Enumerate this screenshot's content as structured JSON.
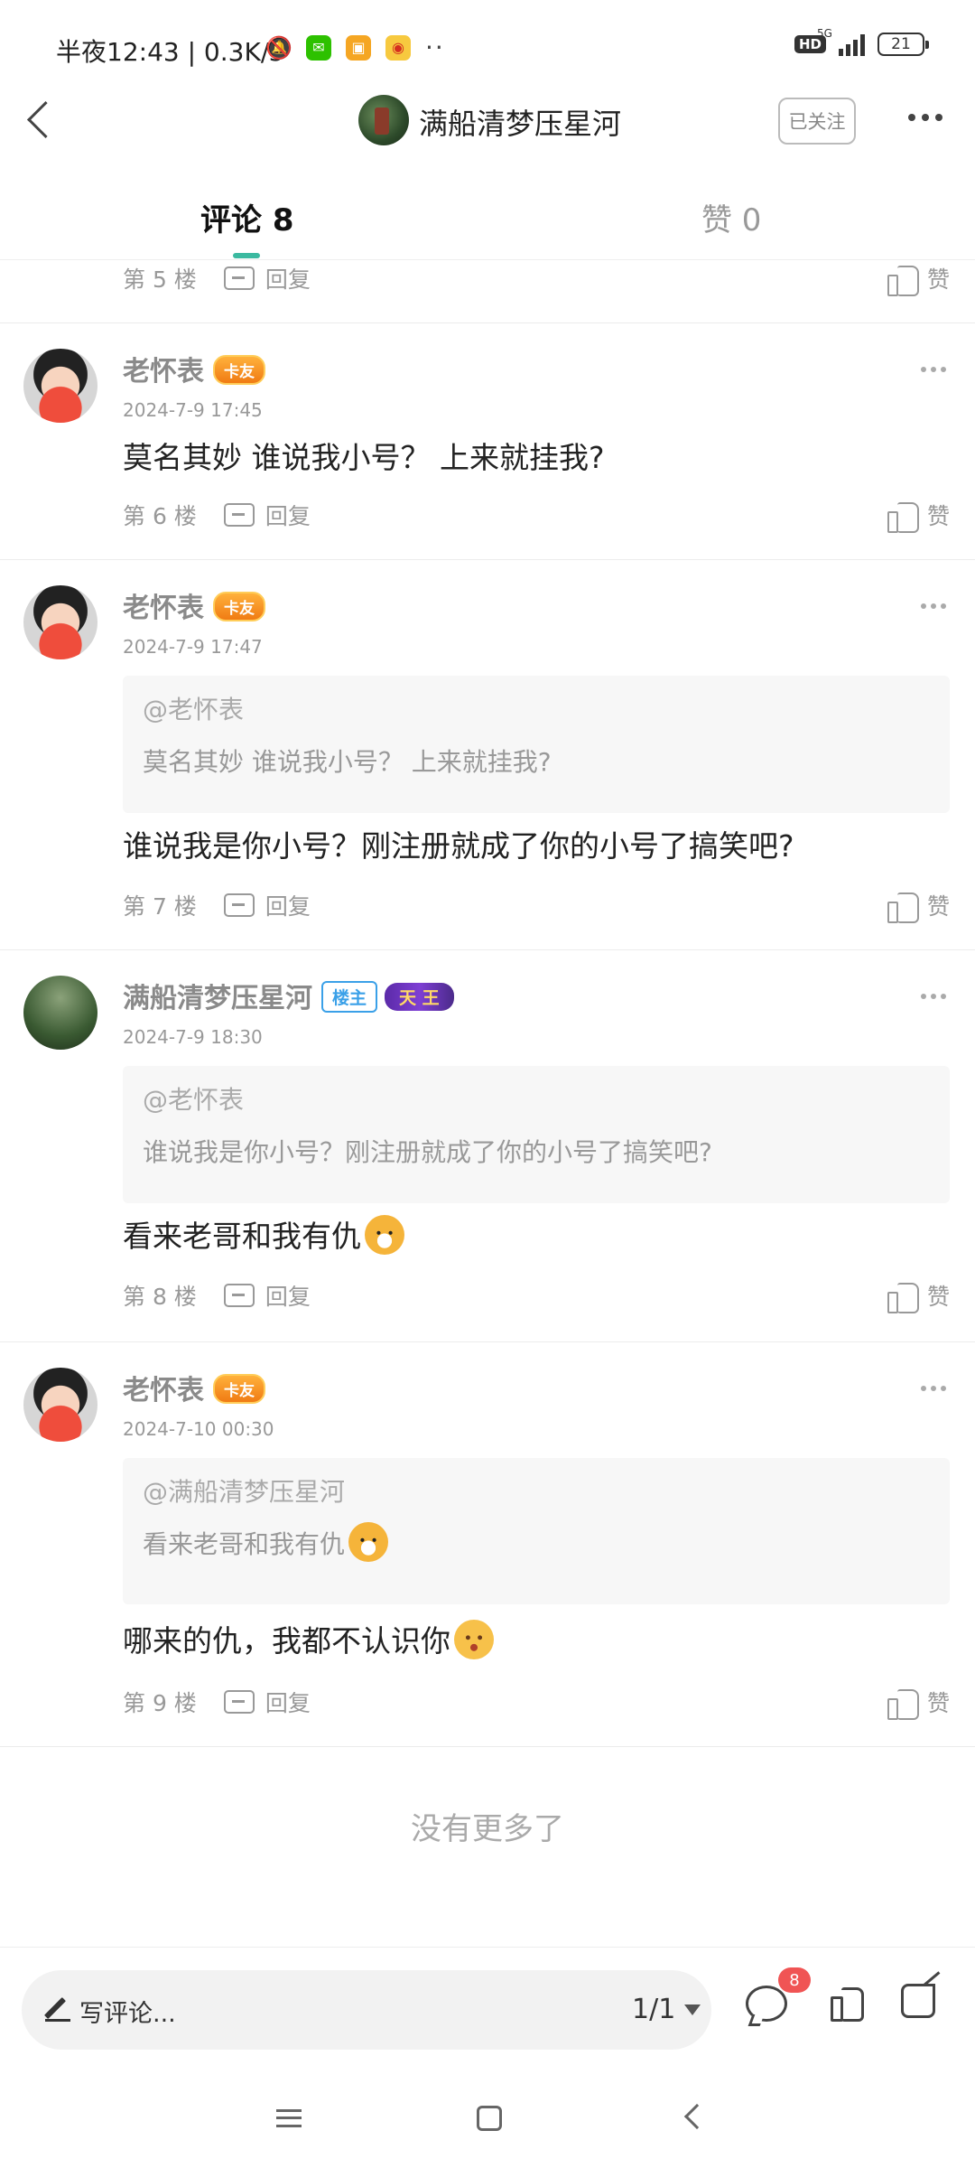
{
  "status_bar": {
    "time_text": "半夜12:43 | 0.3K/s",
    "hd": "HD",
    "network": "5G",
    "battery": "21"
  },
  "header": {
    "title": "满船清梦压星河",
    "follow_label": "已关注"
  },
  "tabs": {
    "comments_label": "评论 8",
    "likes_label": "赞 0"
  },
  "partial_row": {
    "floor": "第 5 楼",
    "reply": "回复",
    "like": "赞"
  },
  "comments": [
    {
      "user": "老怀表",
      "badge": "卡友",
      "date": "2024-7-9 17:45",
      "text": "莫名其妙 谁说我小号？  上来就挂我?",
      "floor": "第 6 楼",
      "reply": "回复",
      "like": "赞"
    },
    {
      "user": "老怀表",
      "badge": "卡友",
      "date": "2024-7-9 17:47",
      "quote_at": "@老怀表",
      "quote_text": "莫名其妙 谁说我小号？  上来就挂我?",
      "text": "谁说我是你小号？刚注册就成了你的小号了搞笑吧?",
      "floor": "第 7 楼",
      "reply": "回复",
      "like": "赞"
    },
    {
      "user": "满船清梦压星河",
      "owner_badge": "楼主",
      "king_badge": "天 王",
      "date": "2024-7-9 18:30",
      "quote_at": "@老怀表",
      "quote_text": "谁说我是你小号？刚注册就成了你的小号了搞笑吧?",
      "text": "看来老哥和我有仇",
      "floor": "第 8 楼",
      "reply": "回复",
      "like": "赞"
    },
    {
      "user": "老怀表",
      "badge": "卡友",
      "date": "2024-7-10 00:30",
      "quote_at": "@满船清梦压星河",
      "quote_text": "看来老哥和我有仇",
      "text": "哪来的仇，我都不认识你",
      "floor": "第 9 楼",
      "reply": "回复",
      "like": "赞"
    }
  ],
  "no_more": "没有更多了",
  "bottom_bar": {
    "write_placeholder": "写评论...",
    "page_indicator": "1/1",
    "comment_count": "8"
  }
}
